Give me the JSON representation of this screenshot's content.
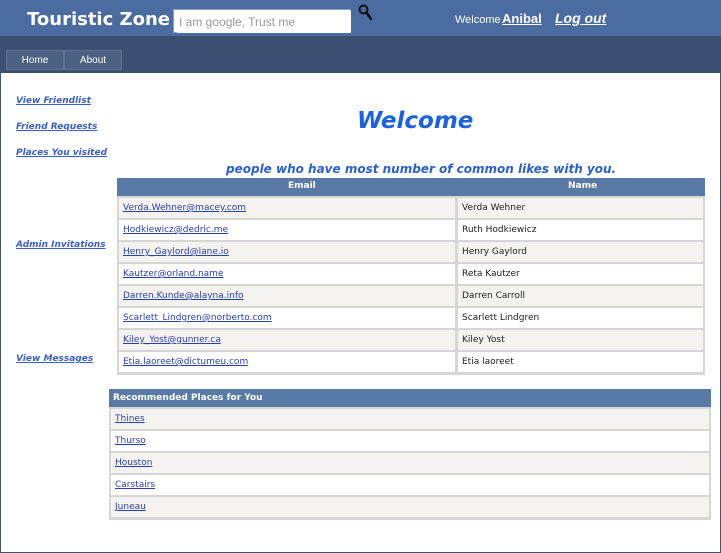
{
  "header": {
    "brand": "Touristic Zone",
    "search_placeholder": "I am google, Trust me",
    "welcome_label": "Welcome",
    "username": "Anibal",
    "logout_label": "Log out"
  },
  "nav": {
    "home": "Home",
    "about": "About"
  },
  "sidebar": {
    "items": [
      {
        "label": "View Friendlist"
      },
      {
        "label": "Friend Requests"
      },
      {
        "label": "Places You visited"
      },
      {
        "label": "Admin Invitations"
      },
      {
        "label": "View Messages"
      }
    ]
  },
  "main": {
    "title": "Welcome",
    "subtitle": "people who have most number of common likes with you."
  },
  "common_likes": {
    "columns": [
      "Email",
      "Name"
    ],
    "rows": [
      {
        "email": "Verda.Wehner@macey.com",
        "name": "Verda Wehner"
      },
      {
        "email": "Hodkiewicz@dedric.me",
        "name": "Ruth Hodkiewicz"
      },
      {
        "email": "Henry_Gaylord@lane.io",
        "name": "Henry Gaylord"
      },
      {
        "email": "Kautzer@orland.name",
        "name": "Reta Kautzer"
      },
      {
        "email": "Darren.Kunde@alayna.info",
        "name": "Darren Carroll"
      },
      {
        "email": "Scarlett_Lindgren@norberto.com",
        "name": "Scarlett Lindgren"
      },
      {
        "email": "Kiley_Yost@gunner.ca",
        "name": "Kiley Yost"
      },
      {
        "email": "Etia.laoreet@dictumeu.com",
        "name": "Etia laoreet"
      }
    ]
  },
  "recommended": {
    "title": "Recommended Places for You",
    "places": [
      "Thines",
      "Thurso",
      "Houston",
      "Carstairs",
      "Juneau"
    ]
  },
  "colors": {
    "header_bg": "#4b6ca0",
    "nav_bg": "#3b5070",
    "table_header_bg": "#5a7aa6",
    "title_blue": "#1a62e0"
  }
}
